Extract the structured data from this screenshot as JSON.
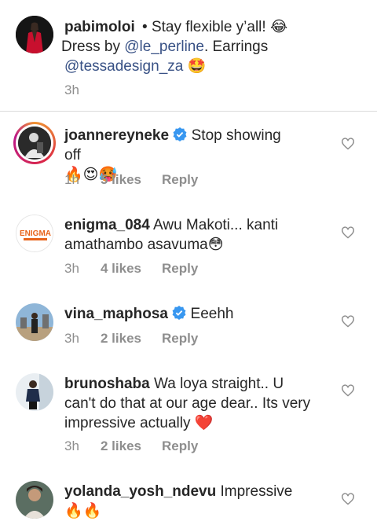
{
  "caption": {
    "username": "pabimoloi",
    "separator": "•",
    "text_1": " Stay flexible y’all! ",
    "text_2": " Dress by ",
    "mention_1": "@le_perline",
    "text_3": ". Earrings ",
    "mention_2": "@tessadesign_za",
    "emoji_laugh": "😂",
    "emoji_star_eyes": "🤩",
    "time": "3h"
  },
  "comments": [
    {
      "username": "joannereyneke",
      "verified": true,
      "text": " Stop showing off",
      "emojis": "🔥😍🥵",
      "time": "1h",
      "likes": "5 likes",
      "reply": "Reply"
    },
    {
      "username": "enigma_084",
      "verified": false,
      "text": " Awu Makoti... kanti amathambo asavuma",
      "emojis": "😳",
      "time": "3h",
      "likes": "4 likes",
      "reply": "Reply",
      "avatar_text": "ENIGMA"
    },
    {
      "username": "vina_maphosa",
      "verified": true,
      "text": " Eeehh",
      "emojis": "",
      "time": "3h",
      "likes": "2 likes",
      "reply": "Reply"
    },
    {
      "username": "brunoshaba",
      "verified": false,
      "text": " Wa loya straight.. U can't do that at our age dear.. Its very impressive actually ",
      "emojis": "❤️",
      "time": "3h",
      "likes": "2 likes",
      "reply": "Reply"
    },
    {
      "username": "yolanda_yosh_ndevu",
      "verified": false,
      "text": " Impressive ",
      "emojis": "🔥🔥",
      "time": "",
      "likes": "",
      "reply": ""
    }
  ],
  "colors": {
    "mention": "#385185",
    "meta": "#8e8e8e",
    "verified": "#3897f0",
    "heart_outline": "#8e8e8e"
  },
  "icons": {
    "heart": "heart-outline-icon",
    "verified": "verified-badge-icon"
  }
}
